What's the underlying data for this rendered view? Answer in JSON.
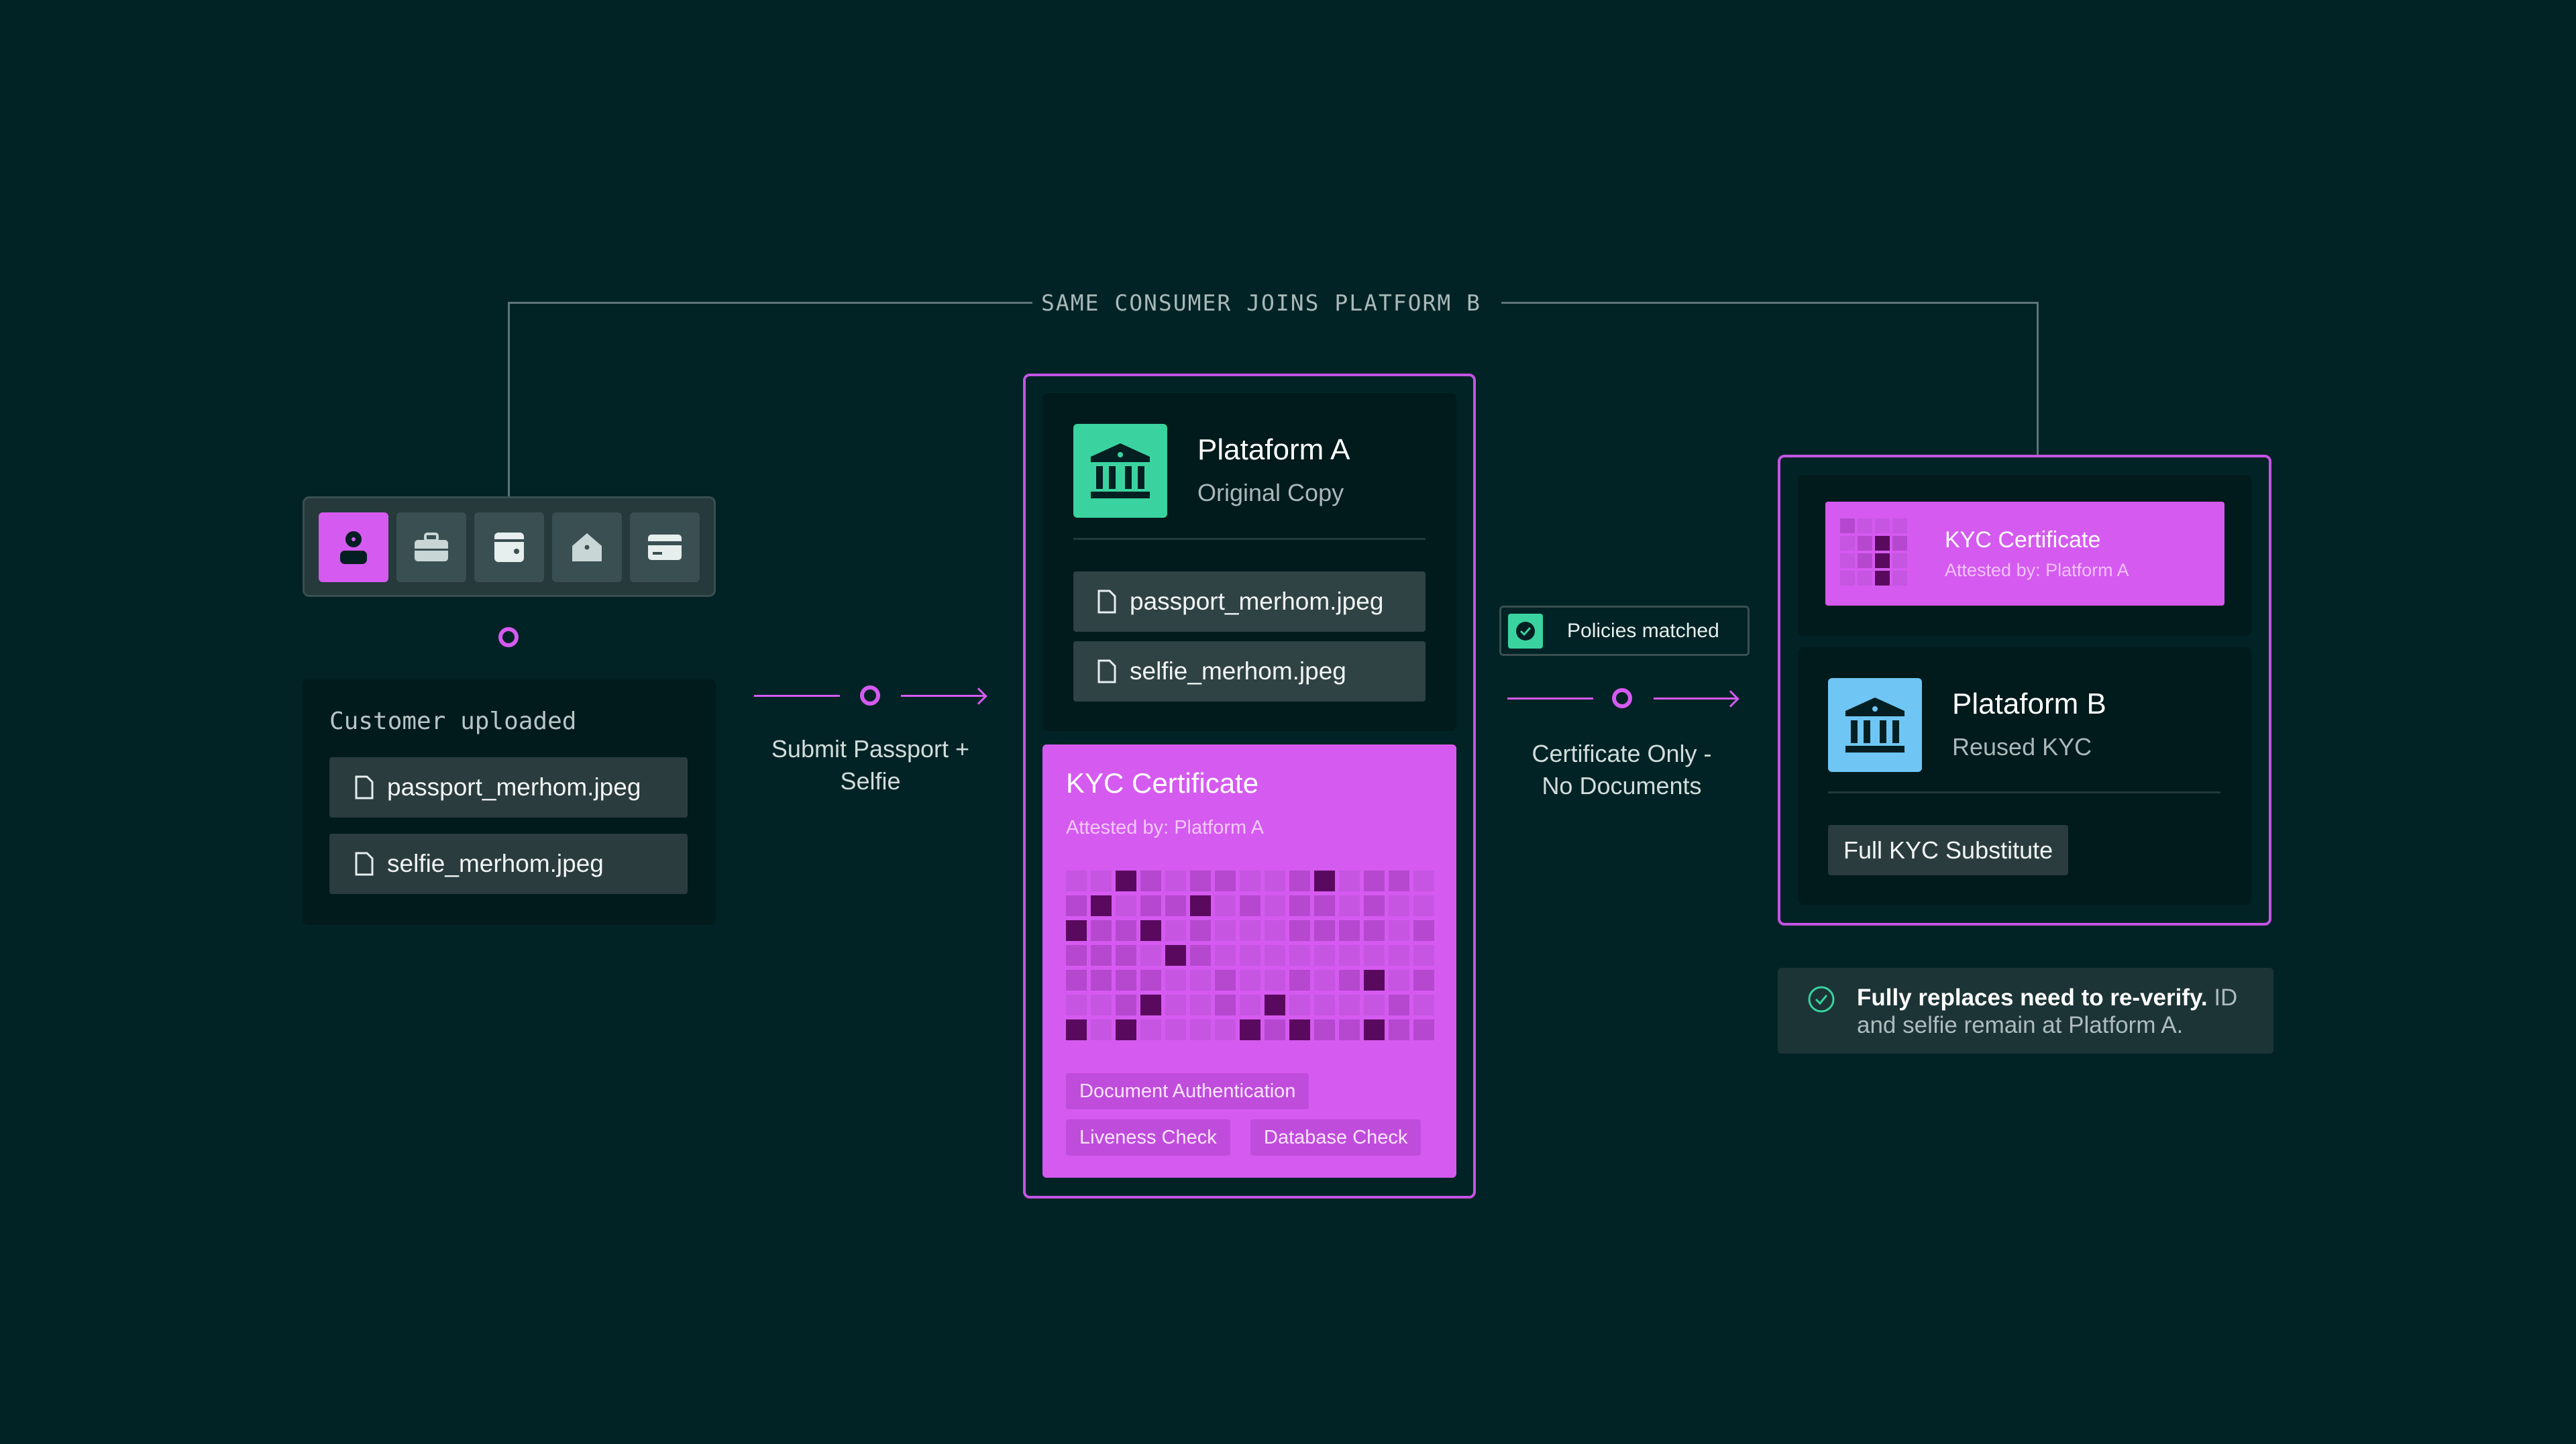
{
  "banner": {
    "label": "SAME CONSUMER JOINS PLATFORM B"
  },
  "icon_row": {
    "items": [
      {
        "icon": "person-icon",
        "active": true
      },
      {
        "icon": "briefcase-icon",
        "active": false
      },
      {
        "icon": "wallet-icon",
        "active": false
      },
      {
        "icon": "home-icon",
        "active": false
      },
      {
        "icon": "credit-card-icon",
        "active": false
      }
    ]
  },
  "customer": {
    "title": "Customer uploaded",
    "files": [
      "passport_merhom.jpeg",
      "selfie_merhom.jpeg"
    ]
  },
  "step1": {
    "line1": "Submit Passport +",
    "line2": "Selfie"
  },
  "platform_a": {
    "title": "Plataform A",
    "subtitle": "Original Copy",
    "files": [
      "passport_merhom.jpeg",
      "selfie_merhom.jpeg"
    ]
  },
  "kyc_certificate": {
    "title": "KYC Certificate",
    "attested": "Attested by: Platform A",
    "tags": [
      "Document Authentication",
      "Liveness Check",
      "Database Check"
    ]
  },
  "policies": {
    "label": "Policies matched"
  },
  "step2": {
    "line1": "Certificate Only -",
    "line2": "No Documents"
  },
  "kyc_mini": {
    "title": "KYC Certificate",
    "attested": "Attested by: Platform A"
  },
  "platform_b": {
    "title": "Plataform B",
    "subtitle": "Reused KYC",
    "badge": "Full KYC Substitute"
  },
  "note": {
    "bold": "Fully replaces need to re-verify.",
    "rest": " ID and selfie remain at Platform A."
  },
  "colors": {
    "background": "#022325",
    "accent_magenta": "#d55af0",
    "platform_a_green": "#3ad39f",
    "platform_b_blue": "#6fc6f4"
  }
}
